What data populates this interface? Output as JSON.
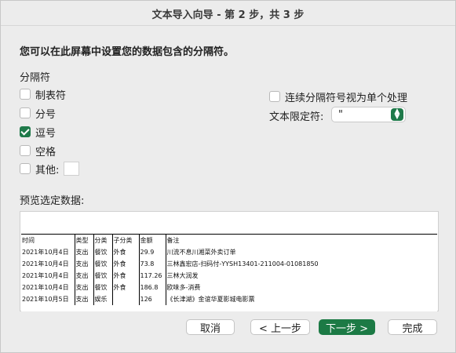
{
  "window": {
    "title": "文本导入向导 - 第 2 步，共 3 步"
  },
  "heading": "您可以在此屏幕中设置您的数据包含的分隔符。",
  "delimiters": {
    "group_label": "分隔符",
    "items": [
      {
        "label": "制表符",
        "checked": false
      },
      {
        "label": "分号",
        "checked": false
      },
      {
        "label": "逗号",
        "checked": true
      },
      {
        "label": "空格",
        "checked": false
      },
      {
        "label": "其他:",
        "checked": false
      }
    ],
    "other_value": ""
  },
  "consecutive": {
    "label": "连续分隔符号视为单个处理",
    "checked": false
  },
  "qualifier": {
    "label": "文本限定符:",
    "value": "\""
  },
  "preview": {
    "label": "预览选定数据:",
    "rows": [
      [
        "时间",
        "类型",
        "分类",
        "子分类",
        "金额",
        "备注"
      ],
      [
        "2021年10月4日",
        "支出",
        "餐饮",
        "外食",
        "29.9",
        "川流不息川湘菜外卖订单"
      ],
      [
        "2021年10月4日",
        "支出",
        "餐饮",
        "外食",
        "73.8",
        "三林鑫宏店-扫码付-YYSH13401-211004-01081850"
      ],
      [
        "2021年10月4日",
        "支出",
        "餐饮",
        "外食",
        "117.26",
        "三林大润发"
      ],
      [
        "2021年10月4日",
        "支出",
        "餐饮",
        "外食",
        "186.8",
        "欧味多-消费"
      ],
      [
        "2021年10月5日",
        "支出",
        "娱乐",
        "",
        "126",
        "《长津湖》金谊华夏影城电影票"
      ]
    ]
  },
  "buttons": {
    "cancel": "取消",
    "back": "< 上一步",
    "next": "下一步 >",
    "finish": "完成"
  },
  "colors": {
    "accent": "#1c7a45"
  }
}
